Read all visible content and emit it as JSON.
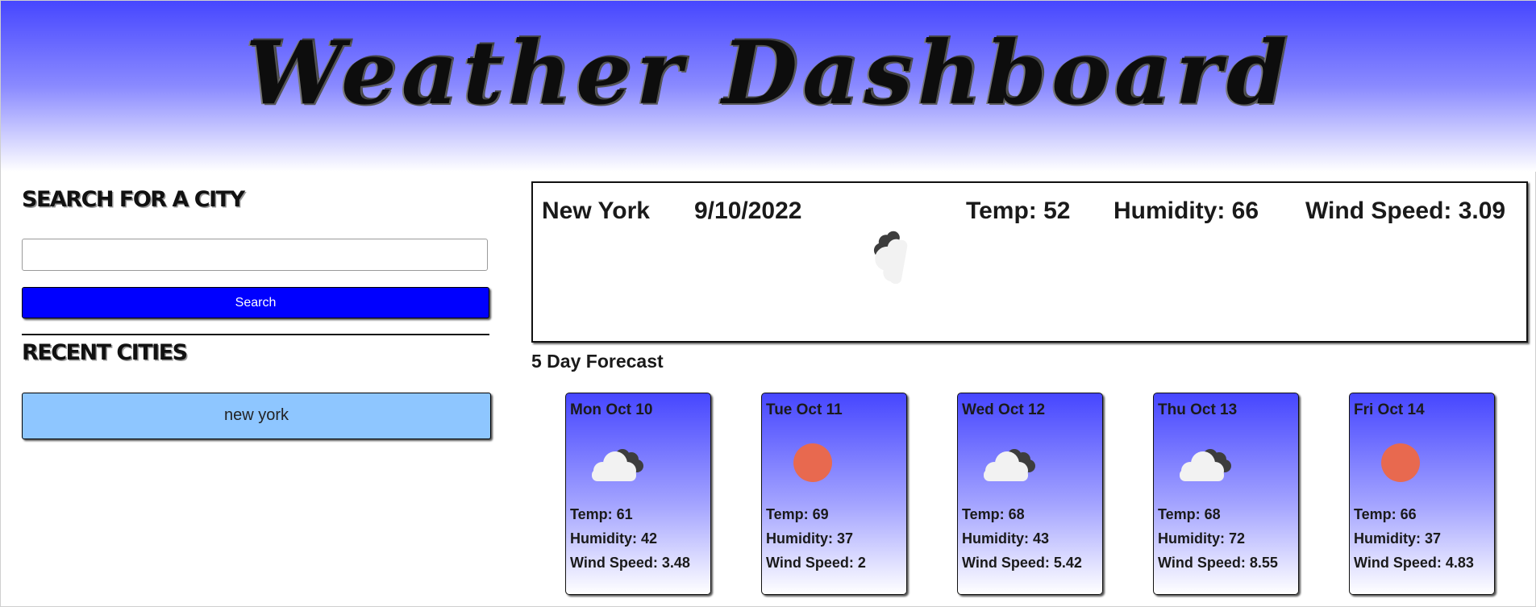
{
  "header": {
    "title": "Weather Dashboard"
  },
  "sidebar": {
    "search_heading": "SEARCH FOR A CITY",
    "search_input_value": "",
    "search_button_label": "Search",
    "recent_heading": "RECENT CITIES",
    "recent_cities": [
      "new york"
    ]
  },
  "current": {
    "city": "New York",
    "date": "9/10/2022",
    "temp": "Temp: 52",
    "humidity": "Humidity: 66",
    "wind": "Wind Speed: 3.09",
    "icon": "cloudy-icon"
  },
  "forecast": {
    "title": "5 Day Forecast",
    "days": [
      {
        "date": "Mon Oct 10",
        "icon": "cloudy-icon",
        "temp": "Temp: 61",
        "humidity": "Humidity: 42",
        "wind": "Wind Speed: 3.48"
      },
      {
        "date": "Tue Oct 11",
        "icon": "sun-icon",
        "temp": "Temp: 69",
        "humidity": "Humidity: 37",
        "wind": "Wind Speed: 2"
      },
      {
        "date": "Wed Oct 12",
        "icon": "cloudy-icon",
        "temp": "Temp: 68",
        "humidity": "Humidity: 43",
        "wind": "Wind Speed: 5.42"
      },
      {
        "date": "Thu Oct 13",
        "icon": "cloudy-icon",
        "temp": "Temp: 68",
        "humidity": "Humidity: 72",
        "wind": "Wind Speed: 8.55"
      },
      {
        "date": "Fri Oct 14",
        "icon": "sun-icon",
        "temp": "Temp: 66",
        "humidity": "Humidity: 37",
        "wind": "Wind Speed: 4.83"
      }
    ]
  },
  "colors": {
    "header_top": "#4747ff",
    "search_button": "#0000ff",
    "recent_city_bg": "#8ec6ff",
    "card_top": "#4646ff",
    "sun": "#e8694f"
  }
}
